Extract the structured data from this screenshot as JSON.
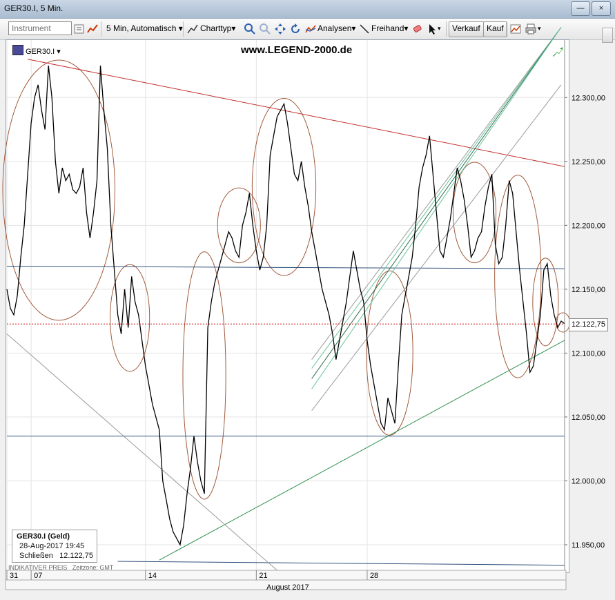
{
  "window": {
    "title": "GER30.I, 5 Min."
  },
  "toolbar": {
    "instrument_placeholder": "Instrument",
    "interval_label": "5 Min,  Automatisch",
    "chart_type_label": "Charttyp",
    "analysis_label": "Analysen",
    "freehand_label": "Freihand",
    "sell_label": "Verkauf",
    "buy_label": "Kauf"
  },
  "chart_header": {
    "instrument": "GER30.I",
    "watermark": "www.LEGEND-2000.de"
  },
  "infobox": {
    "title": "GER30.I (Geld)",
    "datetime": "28-Aug-2017 19:45",
    "close_label": "Schließen",
    "close_value": "12.122,75"
  },
  "footer": {
    "indicative": "INDIKATIVER PREIS",
    "timezone": "Zeitzone: GMT",
    "month": "August 2017"
  },
  "colors": {
    "price_line": "#000000",
    "trend_red": "#c0302e",
    "support_blue": "#2e4f7a",
    "channel_green": "#2f8f4f",
    "ellipse": "#a05a3a",
    "current_price": "#d00000"
  },
  "chart_data": {
    "type": "line",
    "title": "GER30.I, 5 Min.",
    "ylabel": "",
    "xlabel": "August 2017",
    "ylim": [
      11930,
      12345
    ],
    "y_ticks": [
      "12.300,00",
      "12.250,00",
      "12.200,00",
      "12.150,00",
      "12.100,00",
      "12.050,00",
      "12.000,00",
      "11.950,00"
    ],
    "y_tick_values": [
      12300,
      12250,
      12200,
      12150,
      12100,
      12050,
      12000,
      11950
    ],
    "x_tick_labels": [
      "31",
      "07",
      "14",
      "21",
      "28"
    ],
    "x_tick_index": [
      0,
      7,
      40,
      72,
      104
    ],
    "current_price": 12122.75,
    "current_price_label": "12.122,75",
    "series": [
      {
        "values": [
          12150,
          12135,
          12130,
          12145,
          12175,
          12200,
          12240,
          12280,
          12300,
          12310,
          12290,
          12275,
          12325,
          12300,
          12250,
          12225,
          12245,
          12235,
          12240,
          12228,
          12225,
          12230,
          12245,
          12210,
          12190,
          12210,
          12235,
          12325,
          12290,
          12260,
          12200,
          12165,
          12130,
          12115,
          12150,
          12120,
          12160,
          12140,
          12130,
          12110,
          12090,
          12075,
          12060,
          12050,
          12040,
          12000,
          11985,
          11970,
          11960,
          11955,
          11950,
          11965,
          11990,
          12010,
          12035,
          12015,
          12000,
          11990,
          12120,
          12140,
          12155,
          12165,
          12175,
          12185,
          12195,
          12190,
          12180,
          12175,
          12200,
          12210,
          12225,
          12200,
          12180,
          12165,
          12175,
          12200,
          12255,
          12270,
          12285,
          12290,
          12295,
          12280,
          12260,
          12240,
          12235,
          12250,
          12230,
          12215,
          12195,
          12180,
          12165,
          12150,
          12140,
          12130,
          12115,
          12095,
          12110,
          12125,
          12140,
          12160,
          12180,
          12165,
          12150,
          12140,
          12110,
          12090,
          12075,
          12060,
          12045,
          12040,
          12065,
          12055,
          12045,
          12090,
          12130,
          12145,
          12160,
          12175,
          12200,
          12230,
          12245,
          12255,
          12270,
          12240,
          12210,
          12180,
          12175,
          12190,
          12205,
          12225,
          12245,
          12235,
          12220,
          12200,
          12175,
          12180,
          12190,
          12195,
          12215,
          12230,
          12240,
          12185,
          12170,
          12175,
          12200,
          12235,
          12225,
          12195,
          12165,
          12140,
          12115,
          12085,
          12090,
          12110,
          12130,
          12165,
          12170,
          12145,
          12130,
          12120,
          12125,
          12123
        ]
      }
    ],
    "lines": [
      {
        "name": "resistance",
        "color": "#c0302e",
        "x": [
          6,
          166
        ],
        "y": [
          12330,
          12246
        ]
      },
      {
        "name": "support-horizontal",
        "color": "#2e4f7a",
        "x": [
          0,
          166
        ],
        "y": [
          12168,
          12166
        ]
      },
      {
        "name": "support-low",
        "color": "#2e4f7a",
        "x": [
          0,
          166
        ],
        "y": [
          12035,
          12035
        ]
      },
      {
        "name": "bottom",
        "color": "#2e4f7a",
        "x": [
          32,
          166
        ],
        "y": [
          11937,
          11934
        ]
      },
      {
        "name": "uptrend",
        "color": "#2f8f4f",
        "x": [
          44,
          168
        ],
        "y": [
          11938,
          12110
        ]
      },
      {
        "name": "downtrend-gray",
        "color": "#9a9a9a",
        "x": [
          0,
          78
        ],
        "y": [
          12115,
          11930
        ]
      }
    ],
    "channel": {
      "x_start": 88,
      "x_end": 160,
      "lines": [
        {
          "color": "#9a9a9a",
          "y0": 12095,
          "y1": 12355
        },
        {
          "color": "#66c39a",
          "y0": 12088,
          "y1": 12355
        },
        {
          "color": "#2f6f4f",
          "y0": 12080,
          "y1": 12355
        },
        {
          "color": "#66c39a",
          "y0": 12072,
          "y1": 12355
        },
        {
          "color": "#9a9a9a",
          "y0": 12055,
          "y1": 12310
        }
      ]
    }
  }
}
